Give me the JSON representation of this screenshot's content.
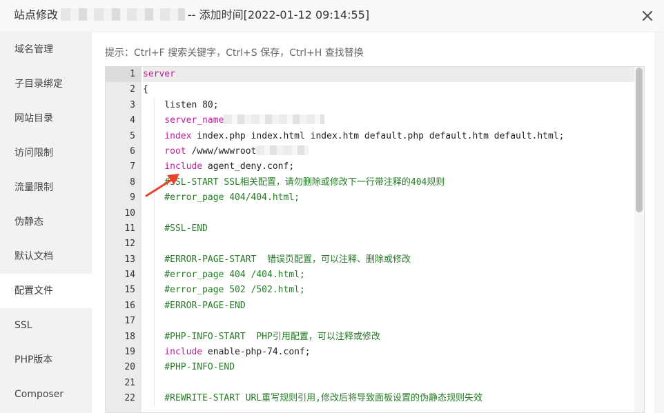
{
  "window": {
    "title_prefix": "站点修改",
    "title_suffix": "-- 添加时间[2022-01-12 09:14:55]",
    "close_label": "×"
  },
  "sidebar": {
    "items": [
      {
        "label": "域名管理"
      },
      {
        "label": "子目录绑定"
      },
      {
        "label": "网站目录"
      },
      {
        "label": "访问限制"
      },
      {
        "label": "流量限制"
      },
      {
        "label": "伪静态"
      },
      {
        "label": "默认文档"
      },
      {
        "label": "配置文件",
        "active": true
      },
      {
        "label": "SSL"
      },
      {
        "label": "PHP版本"
      },
      {
        "label": "Composer"
      }
    ]
  },
  "editor": {
    "hint": "提示：Ctrl+F 搜索关键字，Ctrl+S 保存，Ctrl+H 查找替换",
    "active_line": 1,
    "lines": [
      {
        "n": "1",
        "kw": "server",
        "text": "",
        "type": "kw"
      },
      {
        "n": "2",
        "kw": "",
        "text": "{",
        "type": "plain"
      },
      {
        "n": "3",
        "kw": "",
        "text": "    listen 80;",
        "type": "plain"
      },
      {
        "n": "4",
        "kw": "    server_name",
        "text": "",
        "type": "kw",
        "redact": "long"
      },
      {
        "n": "5",
        "kw": "    index",
        "text": " index.php index.html index.htm default.php default.htm default.html;",
        "type": "kw"
      },
      {
        "n": "6",
        "kw": "    root",
        "text": " /www/wwwroot",
        "type": "kw",
        "redact": "short"
      },
      {
        "n": "7",
        "kw": "    include",
        "text": " agent_deny.conf;",
        "type": "kw"
      },
      {
        "n": "8",
        "kw": "",
        "text": "    #SSL-START SSL相关配置，请勿删除或修改下一行带注释的404规则",
        "type": "cm"
      },
      {
        "n": "9",
        "kw": "",
        "text": "    #error_page 404/404.html;",
        "type": "cm"
      },
      {
        "n": "10",
        "kw": "",
        "text": "",
        "type": "plain"
      },
      {
        "n": "11",
        "kw": "",
        "text": "    #SSL-END",
        "type": "cm"
      },
      {
        "n": "12",
        "kw": "",
        "text": "",
        "type": "plain"
      },
      {
        "n": "13",
        "kw": "",
        "text": "    #ERROR-PAGE-START  错误页配置，可以注释、删除或修改",
        "type": "cm"
      },
      {
        "n": "14",
        "kw": "",
        "text": "    #error_page 404 /404.html;",
        "type": "cm"
      },
      {
        "n": "15",
        "kw": "",
        "text": "    #error_page 502 /502.html;",
        "type": "cm"
      },
      {
        "n": "16",
        "kw": "",
        "text": "    #ERROR-PAGE-END",
        "type": "cm"
      },
      {
        "n": "17",
        "kw": "",
        "text": "",
        "type": "plain"
      },
      {
        "n": "18",
        "kw": "",
        "text": "    #PHP-INFO-START  PHP引用配置，可以注释或修改",
        "type": "cm"
      },
      {
        "n": "19",
        "kw": "    include",
        "text": " enable-php-74.conf;",
        "type": "kw"
      },
      {
        "n": "20",
        "kw": "",
        "text": "    #PHP-INFO-END",
        "type": "cm"
      },
      {
        "n": "21",
        "kw": "",
        "text": "",
        "type": "plain"
      },
      {
        "n": "22",
        "kw": "",
        "text": "    #REWRITE-START URL重写规则引用,修改后将导致面板设置的伪静态规则失效",
        "type": "cm"
      }
    ]
  },
  "colors": {
    "keyword": "#c41a9e",
    "comment": "#237c23",
    "annotation_arrow": "#e8412c"
  }
}
